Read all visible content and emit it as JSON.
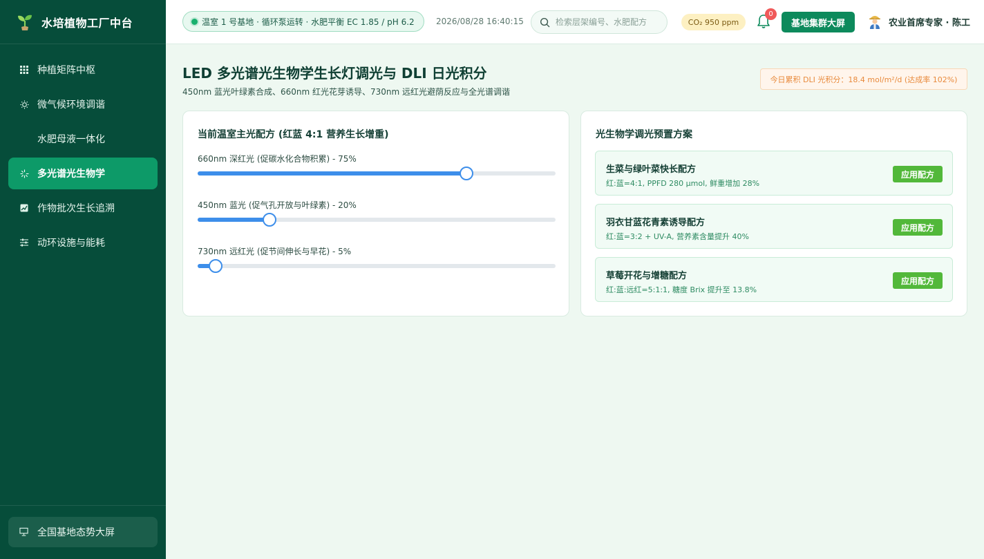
{
  "sidebar": {
    "brand": {
      "name": "水培植物工厂中台",
      "icon": "sprout-icon"
    },
    "items": [
      {
        "label": "种植矩阵中枢",
        "icon": "grid-icon",
        "active": false
      },
      {
        "label": "微气候环境调谐",
        "icon": "sun-icon",
        "active": false
      },
      {
        "label": "水肥母液一体化",
        "icon": "droplet-icon",
        "active": false
      },
      {
        "label": "多光谱光生物学",
        "icon": "sparkle-icon",
        "active": true
      },
      {
        "label": "作物批次生长追溯",
        "icon": "chart-icon",
        "active": false
      },
      {
        "label": "动环设施与能耗",
        "icon": "sliders-icon",
        "active": false
      }
    ],
    "bottom": {
      "label": "全国基地态势大屏",
      "icon": "presentation-icon"
    }
  },
  "header": {
    "status": "温室 1 号基地 · 循环泵运转 · 水肥平衡 EC 1.85 / pH 6.2",
    "datetime": "2026/08/28 16:40:15",
    "search_placeholder": "检索层架编号、水肥配方",
    "co2": "CO₂ 950 ppm",
    "notifications": "0",
    "cluster_button": "基地集群大屏",
    "user_name": "农业首席专家 · 陈工"
  },
  "page": {
    "title": "LED 多光谱光生物学生长灯调光与 DLI 日光积分",
    "subtitle": "450nm 蓝光叶绿素合成、660nm 红光花芽诱导、730nm 远红光避荫反应与全光谱调谐",
    "dli_badge": "今日累积 DLI 光积分：18.4 mol/m²/d (达成率 102%)"
  },
  "formula_card": {
    "title": "当前温室主光配方 (红蓝 4:1 营养生长增重)",
    "sliders": [
      {
        "label": "660nm 深红光 (促碳水化合物积累) - 75%",
        "value": 75
      },
      {
        "label": "450nm 蓝光 (促气孔开放与叶绿素) - 20%",
        "value": 20
      },
      {
        "label": "730nm 远红光 (促节间伸长与早花) - 5%",
        "value": 5
      }
    ]
  },
  "presets_card": {
    "title": "光生物学调光预置方案",
    "presets": [
      {
        "name": "生菜与绿叶菜快长配方",
        "desc": "红:蓝=4:1, PPFD 280 μmol, 鲜重增加 28%",
        "button": "应用配方"
      },
      {
        "name": "羽衣甘蓝花青素诱导配方",
        "desc": "红:蓝=3:2 + UV-A, 营养素含量提升 40%",
        "button": "应用配方"
      },
      {
        "name": "草莓开花与增糖配方",
        "desc": "红:蓝:远红=5:1:1, 糖度 Brix 提升至 13.8%",
        "button": "应用配方"
      }
    ]
  },
  "colors": {
    "sidebar_bg": "#064d3a",
    "active_nav": "#0d9a68",
    "slider_accent": "#3d8eea",
    "apply_button": "#52b83a",
    "dli_text": "#e88a3c"
  }
}
